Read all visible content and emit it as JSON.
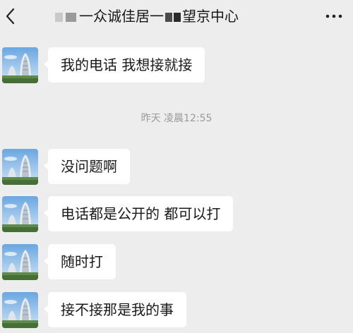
{
  "header": {
    "back_icon": "chevron-left-icon",
    "title_text": "一众诚佳居一",
    "title_suffix": "望京中心",
    "more_icon": "more-dots-icon"
  },
  "messages": [
    {
      "text": "我的电话 我想接就接"
    },
    {
      "text": "没问题啊"
    },
    {
      "text": "电话都是公开的 都可以打"
    },
    {
      "text": "随时打"
    },
    {
      "text": "接不接那是我的事"
    }
  ],
  "timestamp": "昨天 凌晨12:55",
  "colors": {
    "background": "#ededed",
    "bubble": "#ffffff",
    "timestamp": "#999999"
  }
}
